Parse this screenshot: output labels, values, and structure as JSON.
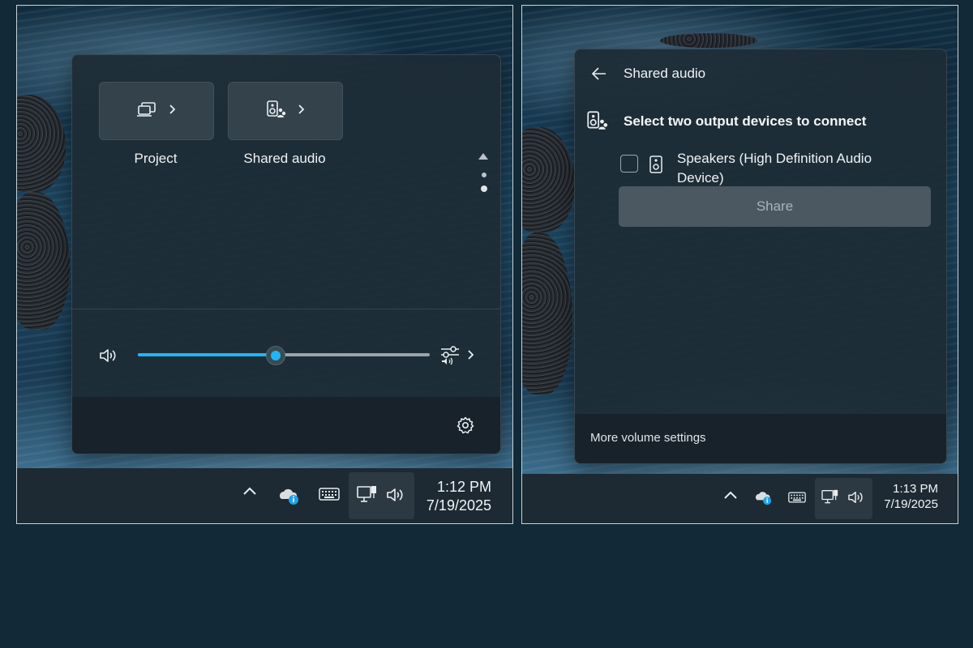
{
  "left": {
    "quick_actions": [
      {
        "label": "Project",
        "icon": "project-icon"
      },
      {
        "label": "Shared audio",
        "icon": "shared-audio-icon"
      }
    ],
    "volume": {
      "level_percent": 47,
      "icon": "speaker-icon",
      "mixer_icon": "sound-mixer-icon"
    },
    "settings_icon": "gear-icon",
    "taskbar": {
      "time": "1:12 PM",
      "date": "7/19/2025"
    }
  },
  "right": {
    "header": {
      "back_icon": "back-arrow-icon",
      "title": "Shared audio"
    },
    "instruction": "Select two output devices to connect",
    "devices": [
      {
        "name": "Speakers (High Definition Audio Device)",
        "checked": false
      }
    ],
    "share_button": "Share",
    "footer_link": "More volume settings",
    "taskbar": {
      "time": "1:13 PM",
      "date": "7/19/2025"
    }
  },
  "colors": {
    "accent": "#1fb6f5",
    "background": "#122a37",
    "taskbar": "#1d2a33"
  }
}
